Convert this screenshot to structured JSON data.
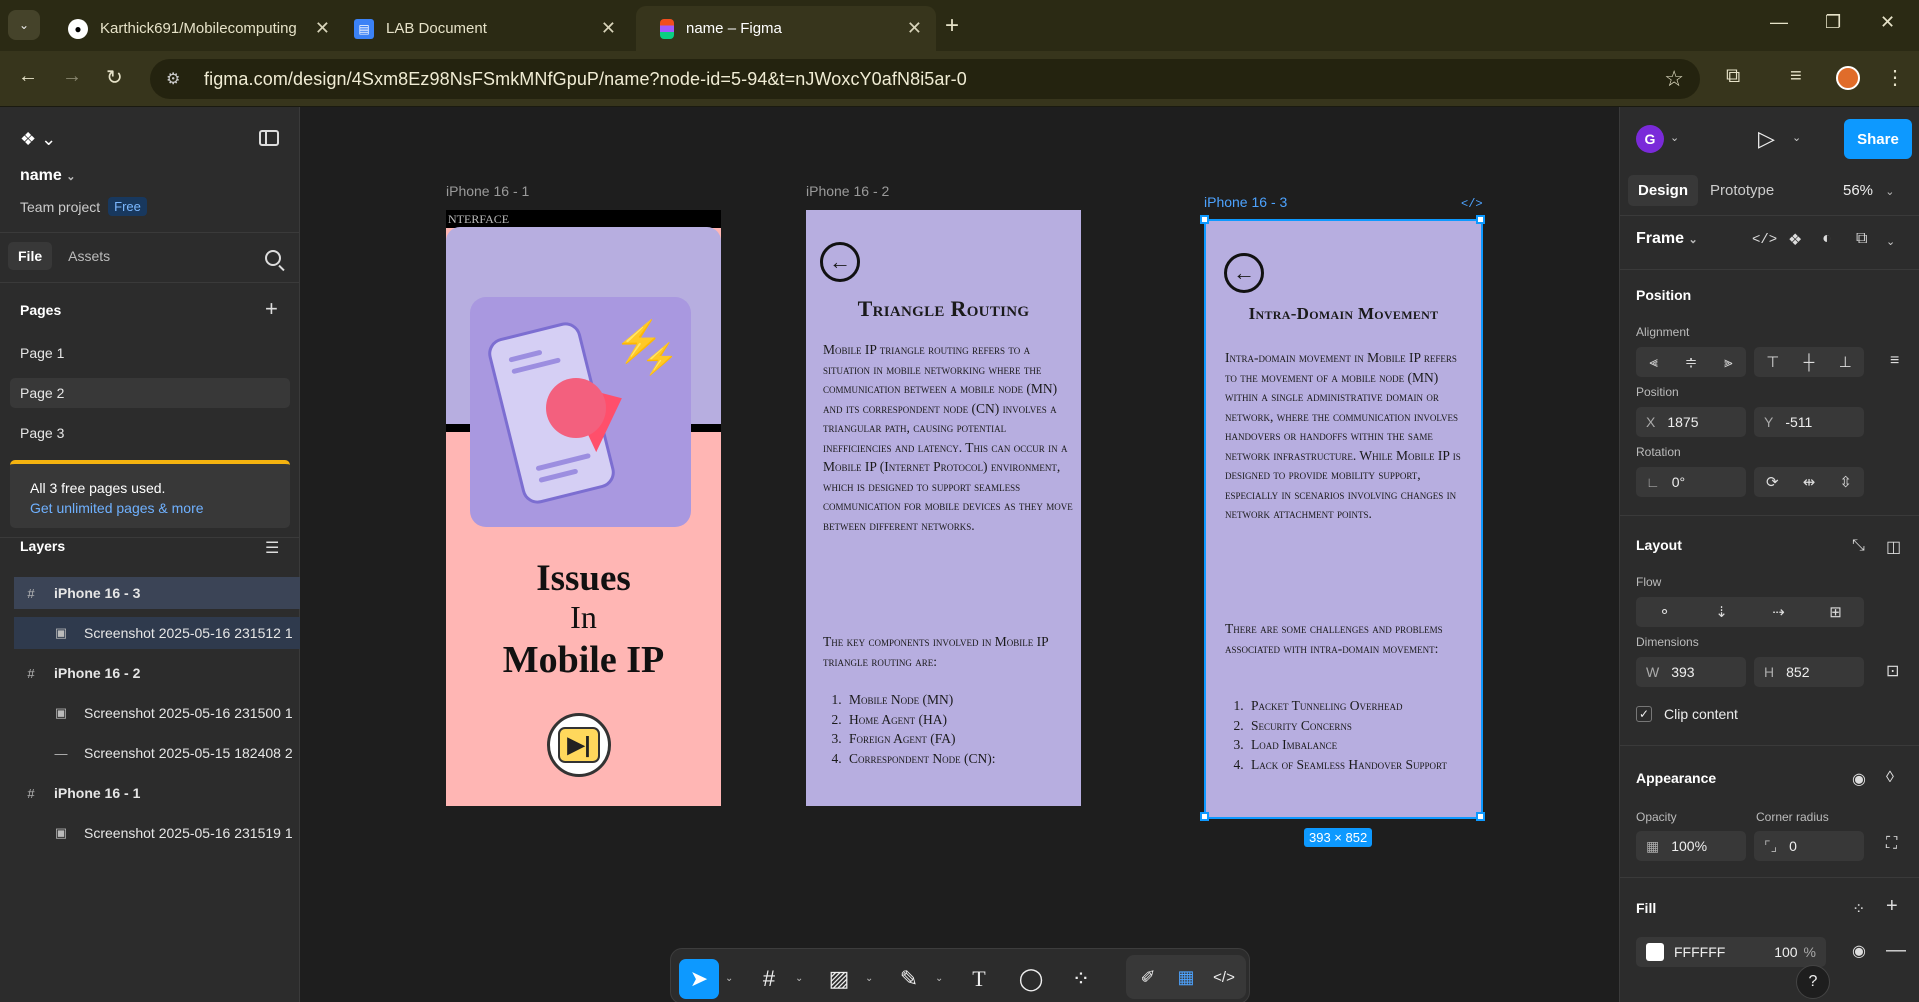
{
  "browser": {
    "tabs": [
      {
        "title": "Karthick691/Mobilecomputing",
        "icon": "github-icon"
      },
      {
        "title": "LAB Document",
        "icon": "document-icon"
      },
      {
        "title": "name – Figma",
        "icon": "figma-icon"
      }
    ],
    "url": "figma.com/design/4Sxm8Ez98NsFSmkMNfGpuP/name?node-id=5-94&t=nJWoxcY0afN8i5ar-0"
  },
  "left_panel": {
    "file_name": "name",
    "team": "Team project",
    "plan_badge": "Free",
    "tabs": [
      "File",
      "Assets"
    ],
    "pages_title": "Pages",
    "pages": [
      "Page 1",
      "Page 2",
      "Page 3"
    ],
    "upsell_text": "All 3 free pages used.",
    "upsell_link": "Get unlimited pages & more",
    "layers_title": "Layers",
    "layers": [
      {
        "name": "iPhone 16 - 3",
        "type": "frame"
      },
      {
        "name": "Screenshot 2025-05-16 231512 1",
        "type": "image"
      },
      {
        "name": "iPhone 16 - 2",
        "type": "frame"
      },
      {
        "name": "Screenshot 2025-05-16 231500 1",
        "type": "image"
      },
      {
        "name": "Screenshot 2025-05-15 182408 2",
        "type": "rect"
      },
      {
        "name": "iPhone 16 - 1",
        "type": "frame"
      },
      {
        "name": "Screenshot 2025-05-16 231519 1",
        "type": "image"
      }
    ]
  },
  "canvas": {
    "frame_labels": [
      "iPhone 16 - 1",
      "iPhone 16 - 2",
      "iPhone 16 - 3"
    ],
    "frame1": {
      "top_text": "NTERFACE",
      "title_line1": "Issues",
      "title_line2": "In",
      "title_line3": "Mobile IP"
    },
    "frame2": {
      "title": "Triangle Routing",
      "body": "Mobile IP triangle routing refers to a situation in mobile networking where the communication between a mobile node (MN) and its correspondent node (CN) involves a triangular path, causing potential inefficiencies and latency. This can occur in a Mobile IP (Internet Protocol) environment, which is designed to support seamless communication for mobile devices as they move between different networks.",
      "intro": "The key components involved in Mobile IP triangle routing are:",
      "items": [
        "Mobile Node (MN)",
        "Home Agent (HA)",
        "Foreign Agent (FA)",
        "Correspondent Node (CN):"
      ]
    },
    "frame3": {
      "title": "Intra-Domain Movement",
      "body": "Intra-domain movement in Mobile IP refers to the movement of a mobile node (MN) within a single administrative domain or network, where the communication involves handovers or handoffs within the same network infrastructure. While Mobile IP is designed to provide mobility support, especially in scenarios involving changes in network attachment points.",
      "intro": "There are some challenges and problems associated with intra-domain movement:",
      "items": [
        "Packet Tunneling Overhead",
        "Security Concerns",
        "Load Imbalance",
        "Lack of Seamless Handover Support"
      ]
    },
    "selection_size": "393 × 852"
  },
  "right_panel": {
    "avatar_initial": "G",
    "share_label": "Share",
    "tabs": [
      "Design",
      "Prototype"
    ],
    "zoom": "56%",
    "frame_label": "Frame",
    "position_title": "Position",
    "alignment_label": "Alignment",
    "position_label": "Position",
    "x_prefix": "X",
    "x_value": "1875",
    "y_prefix": "Y",
    "y_value": "-511",
    "rotation_label": "Rotation",
    "rotation_value": "0°",
    "layout_title": "Layout",
    "flow_label": "Flow",
    "dimensions_label": "Dimensions",
    "w_prefix": "W",
    "w_value": "393",
    "h_prefix": "H",
    "h_value": "852",
    "clip_label": "Clip content",
    "appearance_title": "Appearance",
    "opacity_label": "Opacity",
    "opacity_value": "100%",
    "radius_label": "Corner radius",
    "radius_value": "0",
    "fill_title": "Fill",
    "fill_hex": "FFFFFF",
    "fill_opacity": "100",
    "fill_percent": "%"
  },
  "colors": {
    "accent": "#0d99ff",
    "frame_purple": "#b7aee0",
    "frame_pink": "#ffb6b4"
  }
}
